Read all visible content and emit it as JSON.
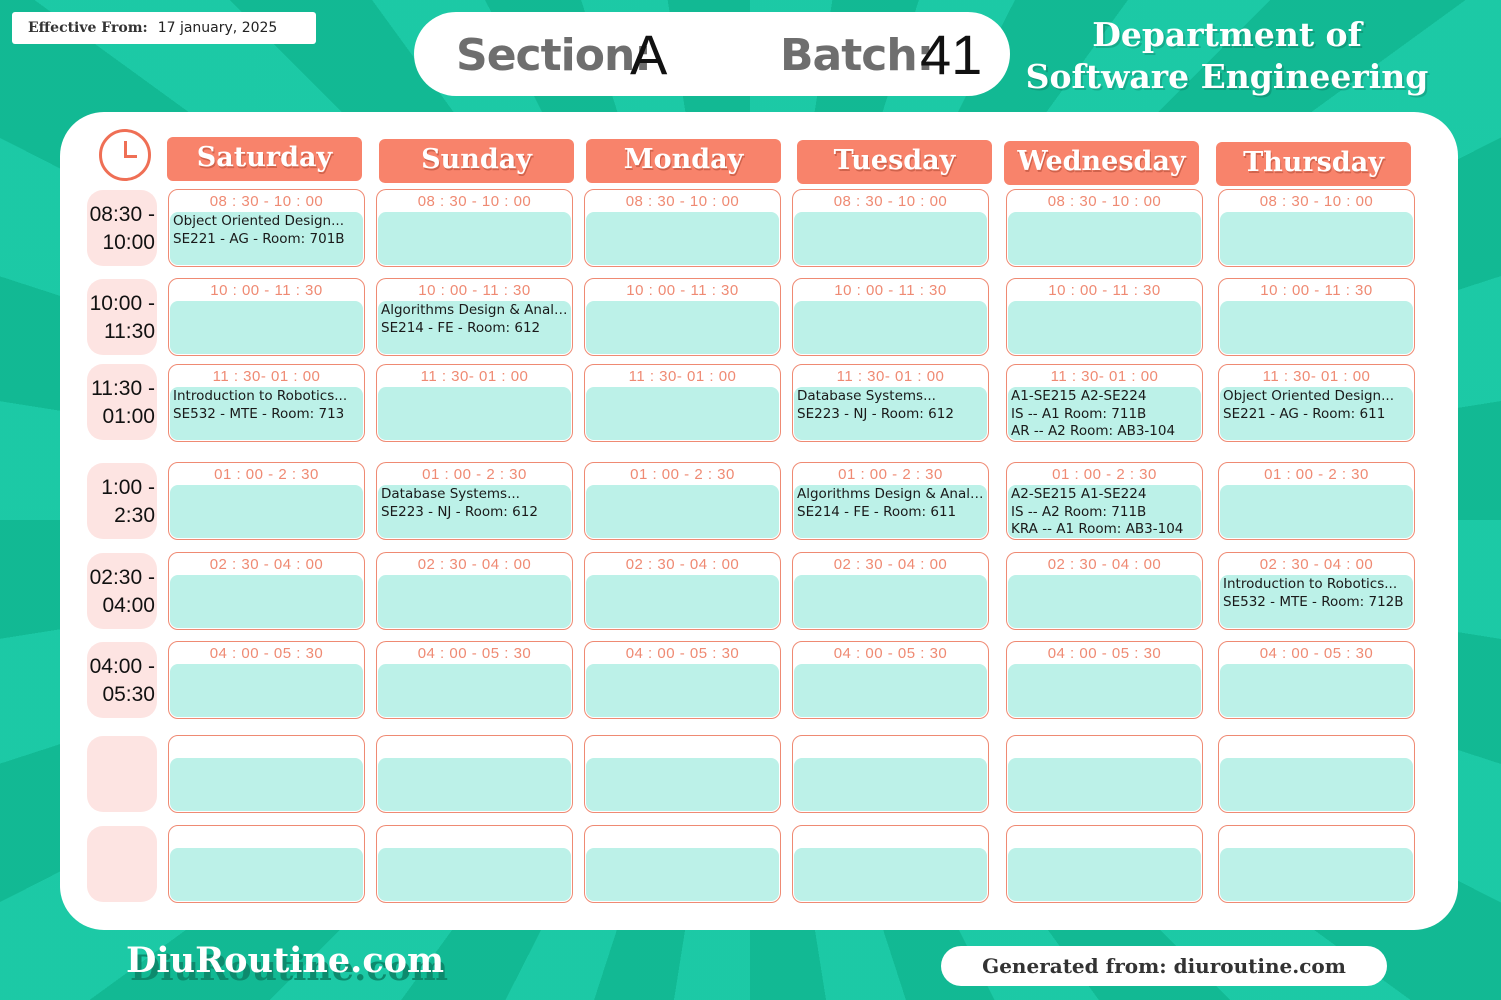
{
  "effective": {
    "label": "Effective From:",
    "date": "17 january, 2025"
  },
  "header": {
    "section_label": "Section:",
    "section_value": "A",
    "batch_label": "Batch:",
    "batch_value": "41"
  },
  "department": {
    "line1": "Department of",
    "line2": "Software Engineering"
  },
  "days": [
    "Saturday",
    "Sunday",
    "Monday",
    "Tuesday",
    "Wednesday",
    "Thursday"
  ],
  "time_slots": [
    {
      "start": "08:30 -",
      "end": "10:00",
      "cell_time": "08 : 30 - 10 : 00"
    },
    {
      "start": "10:00 -",
      "end": "11:30",
      "cell_time": "10 : 00 - 11 : 30"
    },
    {
      "start": "11:30 -",
      "end": "01:00",
      "cell_time": "11 : 30- 01 : 00"
    },
    {
      "start": "1:00 -",
      "end": "2:30",
      "cell_time": "01 : 00 - 2 : 30"
    },
    {
      "start": "02:30 -",
      "end": "04:00",
      "cell_time": "02 : 30 - 04 : 00"
    },
    {
      "start": "04:00 -",
      "end": "05:30",
      "cell_time": "04 : 00 - 05 : 30"
    },
    {
      "start": "",
      "end": "",
      "cell_time": ""
    },
    {
      "start": "",
      "end": "",
      "cell_time": ""
    }
  ],
  "classes": {
    "0_0": [
      "Object Oriented Design...",
      "SE221 - AG - Room: 701B"
    ],
    "1_1": [
      "Algorithms Design & Analysis",
      "SE214 - FE - Room: 612"
    ],
    "2_0": [
      "Introduction to Robotics...",
      "SE532 - MTE - Room: 713"
    ],
    "2_3": [
      "Database Systems...",
      "SE223 - NJ - Room: 612"
    ],
    "2_4": [
      "A1-SE215       A2-SE224",
      "IS --    A1 Room: 711B",
      "AR --    A2 Room: AB3-104"
    ],
    "2_5": [
      "Object Oriented Design...",
      "SE221 - AG - Room: 611"
    ],
    "3_1": [
      "Database Systems...",
      "SE223 - NJ - Room: 612"
    ],
    "3_3": [
      "Algorithms Design & Analysis",
      "SE214 - FE - Room: 611"
    ],
    "3_4": [
      "A2-SE215       A1-SE224",
      "IS --    A2 Room: 711B",
      "KRA --    A1 Room: AB3-104"
    ],
    "4_5": [
      "Introduction to Robotics...",
      "SE532 - MTE - Room: 712B"
    ]
  },
  "footer": {
    "brand": "DiuRoutine.com",
    "generated": "Generated from:  diuroutine.com"
  },
  "colors": {
    "background": "#17c3a0",
    "day_header": "#f8836b",
    "cell_inner": "#bcf1e8",
    "cell_border": "#ef8a73",
    "time_label_bg": "#fde4e2"
  }
}
